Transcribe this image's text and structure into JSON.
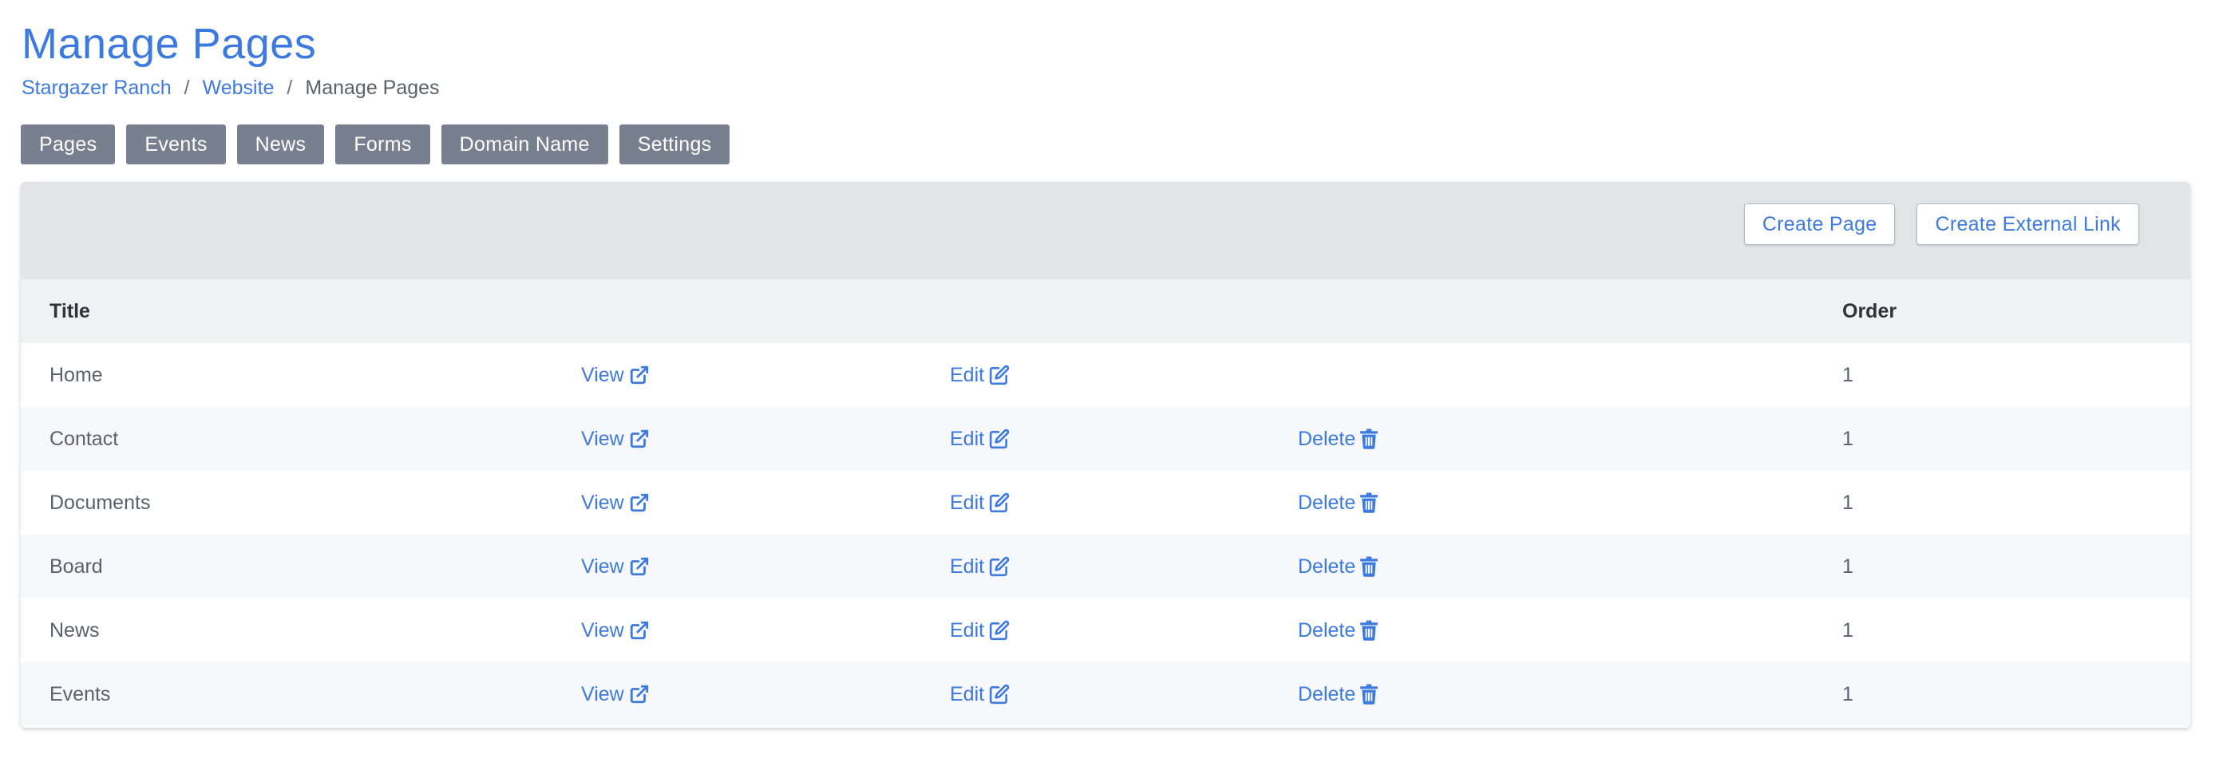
{
  "page": {
    "title": "Manage Pages"
  },
  "breadcrumb": {
    "items": [
      "Stargazer Ranch",
      "Website"
    ],
    "separator": "/",
    "current": "Manage Pages"
  },
  "nav": {
    "tabs": [
      "Pages",
      "Events",
      "News",
      "Forms",
      "Domain Name",
      "Settings"
    ]
  },
  "toolbar": {
    "create_page_label": "Create Page",
    "create_external_link_label": "Create External Link"
  },
  "table": {
    "columns": {
      "title": "Title",
      "order": "Order"
    },
    "actions": {
      "view": "View",
      "edit": "Edit",
      "delete": "Delete"
    },
    "rows": [
      {
        "title": "Home",
        "order": "1",
        "can_delete": false
      },
      {
        "title": "Contact",
        "order": "1",
        "can_delete": true
      },
      {
        "title": "Documents",
        "order": "1",
        "can_delete": true
      },
      {
        "title": "Board",
        "order": "1",
        "can_delete": true
      },
      {
        "title": "News",
        "order": "1",
        "can_delete": true
      },
      {
        "title": "Events",
        "order": "1",
        "can_delete": true
      }
    ]
  },
  "icons": {
    "view": "external-link-icon",
    "edit": "edit-icon",
    "delete": "trash-icon"
  },
  "colors": {
    "accent": "#3d7ae0",
    "tab_bg": "#78808f",
    "toolbar_bg": "#e3e4e6",
    "header_bg": "#f0f1f3",
    "row_alt_bg": "#f7f8fb"
  }
}
